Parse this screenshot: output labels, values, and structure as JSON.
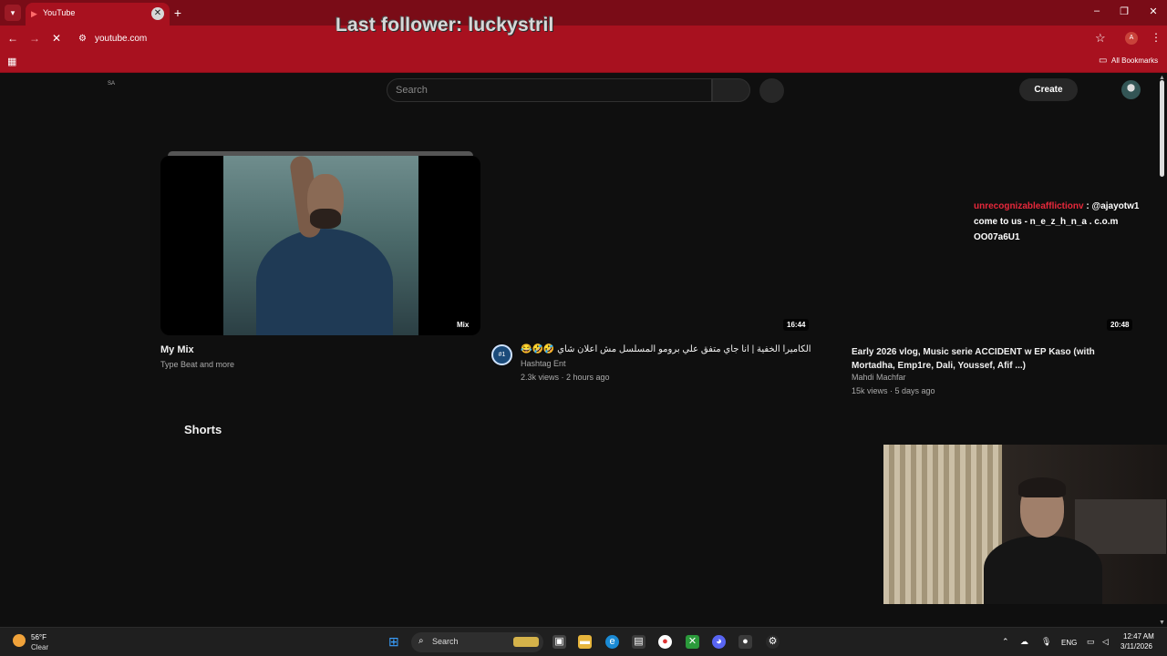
{
  "browser": {
    "tab_title": "YouTube",
    "url": "youtube.com",
    "all_bookmarks": "All Bookmarks",
    "accent": "#a8111f"
  },
  "stream_overlay": {
    "last_follower": "Last follower: luckystril"
  },
  "youtube": {
    "corner_code": "SA",
    "search_placeholder": "Search",
    "create_label": "Create",
    "videos": [
      {
        "title": "My Mix",
        "subtitle": "Type Beat and more",
        "badge": "Mix"
      },
      {
        "title": "الكاميرا الخفية | انا جاي متفق علي برومو المسلسل مش اعلان شاي 🤣🤣😂",
        "channel": "Hashtag Ent",
        "meta": "2.3k views · 2 hours ago",
        "duration": "16:44",
        "channel_icon": "#1"
      },
      {
        "title": "Early 2026 vlog, Music serie ACCIDENT w EP Kaso (with Mortadha, Emp1re, Dali, Youssef, Afif ...)",
        "channel": "Mahdi Machfar",
        "meta": "15k views · 5 days ago",
        "duration": "20:48"
      }
    ],
    "shorts_heading": "Shorts"
  },
  "chat": {
    "user": "unrecognizableafflictionv",
    "message_line1": ": @ajayotw1",
    "message_line2": "come to us - n_e_z_h_n_a . c.o.m",
    "message_line3": "OO07a6U1",
    "user_color": "#e8283b"
  },
  "taskbar": {
    "temp": "56°F",
    "condition": "Clear",
    "search_label": "Search",
    "language": "ENG",
    "time": "12:47 AM",
    "date": "3/11/2026"
  }
}
